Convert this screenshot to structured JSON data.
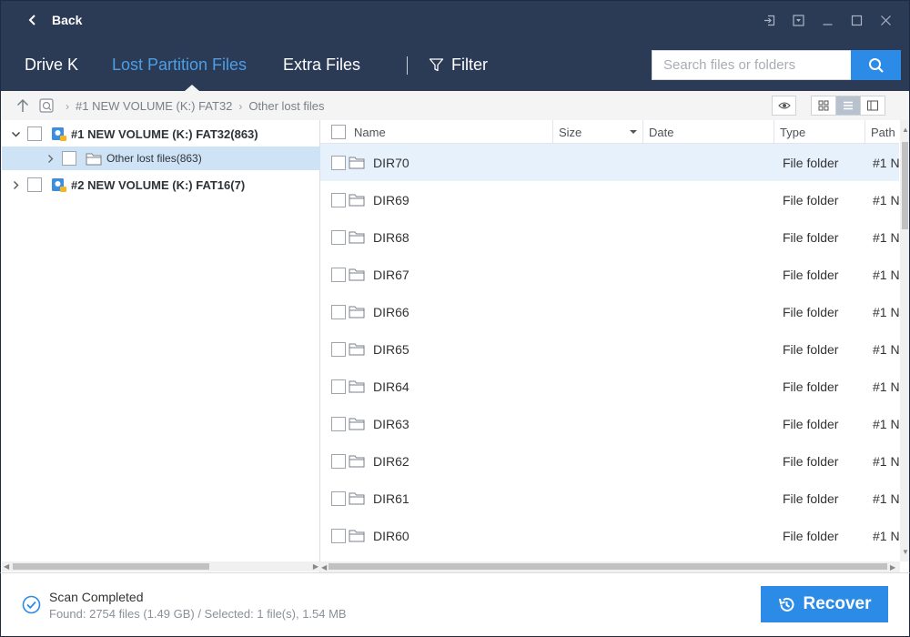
{
  "titlebar": {
    "back_label": "Back",
    "controls": [
      "login-icon",
      "dropdown-icon",
      "minimize-icon",
      "maximize-icon",
      "close-icon"
    ]
  },
  "nav": {
    "tabs": [
      {
        "label": "Drive K",
        "active": false
      },
      {
        "label": "Lost Partition Files",
        "active": true
      },
      {
        "label": "Extra Files",
        "active": false
      }
    ],
    "filter_label": "Filter",
    "search_placeholder": "Search files or folders"
  },
  "breadcrumb": {
    "items": [
      "#1 NEW VOLUME (K:) FAT32",
      "Other lost files"
    ]
  },
  "view_modes": {
    "active": "list",
    "items": [
      "grid-view-icon",
      "list-view-icon",
      "detail-view-icon"
    ]
  },
  "tree": {
    "nodes": [
      {
        "label": "#1 NEW VOLUME (K:) FAT32(863)",
        "expanded": true
      },
      {
        "label": "Other lost files(863)",
        "selected": true
      },
      {
        "label": "#2 NEW VOLUME (K:) FAT16(7)",
        "expanded": false
      }
    ]
  },
  "columns": [
    "Name",
    "Size",
    "Date",
    "Type",
    "Path"
  ],
  "files": [
    {
      "name": "DIR70",
      "type": "File folder",
      "path": "#1 N"
    },
    {
      "name": "DIR69",
      "type": "File folder",
      "path": "#1 N"
    },
    {
      "name": "DIR68",
      "type": "File folder",
      "path": "#1 N"
    },
    {
      "name": "DIR67",
      "type": "File folder",
      "path": "#1 N"
    },
    {
      "name": "DIR66",
      "type": "File folder",
      "path": "#1 N"
    },
    {
      "name": "DIR65",
      "type": "File folder",
      "path": "#1 N"
    },
    {
      "name": "DIR64",
      "type": "File folder",
      "path": "#1 N"
    },
    {
      "name": "DIR63",
      "type": "File folder",
      "path": "#1 N"
    },
    {
      "name": "DIR62",
      "type": "File folder",
      "path": "#1 N"
    },
    {
      "name": "DIR61",
      "type": "File folder",
      "path": "#1 N"
    },
    {
      "name": "DIR60",
      "type": "File folder",
      "path": "#1 N"
    }
  ],
  "footer": {
    "status_title": "Scan Completed",
    "status_detail": "Found: 2754 files (1.49 GB) / Selected: 1 file(s), 1.54 MB",
    "recover_label": "Recover"
  },
  "colors": {
    "header_bg": "#2b3a55",
    "accent": "#2b8be6",
    "active_tab": "#4a9fe8",
    "selected_row": "#cfe3f7"
  }
}
